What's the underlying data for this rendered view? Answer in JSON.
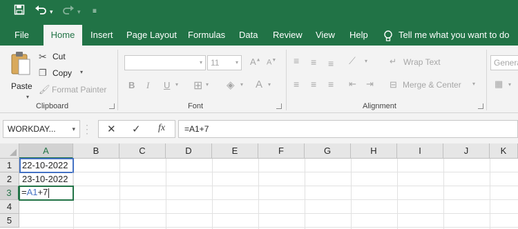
{
  "quick_access": {
    "save_icon": "save-icon",
    "undo_icon": "undo-icon",
    "redo_icon": "redo-icon",
    "customize_icon": "customize-icon"
  },
  "tabs": [
    "File",
    "Home",
    "Insert",
    "Page Layout",
    "Formulas",
    "Data",
    "Review",
    "View",
    "Help"
  ],
  "active_tab": "Home",
  "tell_me": "Tell me what you want to do",
  "ribbon": {
    "clipboard": {
      "paste": "Paste",
      "cut": "Cut",
      "copy": "Copy",
      "format_painter": "Format Painter",
      "label": "Clipboard"
    },
    "font": {
      "font_size": "11",
      "bold": "B",
      "italic": "I",
      "underline": "U",
      "label": "Font"
    },
    "alignment": {
      "wrap_text": "Wrap Text",
      "merge_center": "Merge & Center",
      "label": "Alignment"
    },
    "number": {
      "format": "Genera"
    }
  },
  "formula_bar": {
    "name_box": "WORKDAY...",
    "formula": "=A1+7"
  },
  "grid": {
    "columns": [
      "A",
      "B",
      "C",
      "D",
      "E",
      "F",
      "G",
      "H",
      "I",
      "J",
      "K"
    ],
    "rows": [
      "1",
      "2",
      "3",
      "4",
      "5"
    ],
    "cells": {
      "A1": "22-10-2022",
      "A2": "23-10-2022"
    },
    "editing_cell": {
      "ref": "A3",
      "prefix": "=",
      "ref_part": "A1",
      "suffix": "+7"
    }
  },
  "colors": {
    "accent": "#217346",
    "reference": "#4472c4"
  }
}
